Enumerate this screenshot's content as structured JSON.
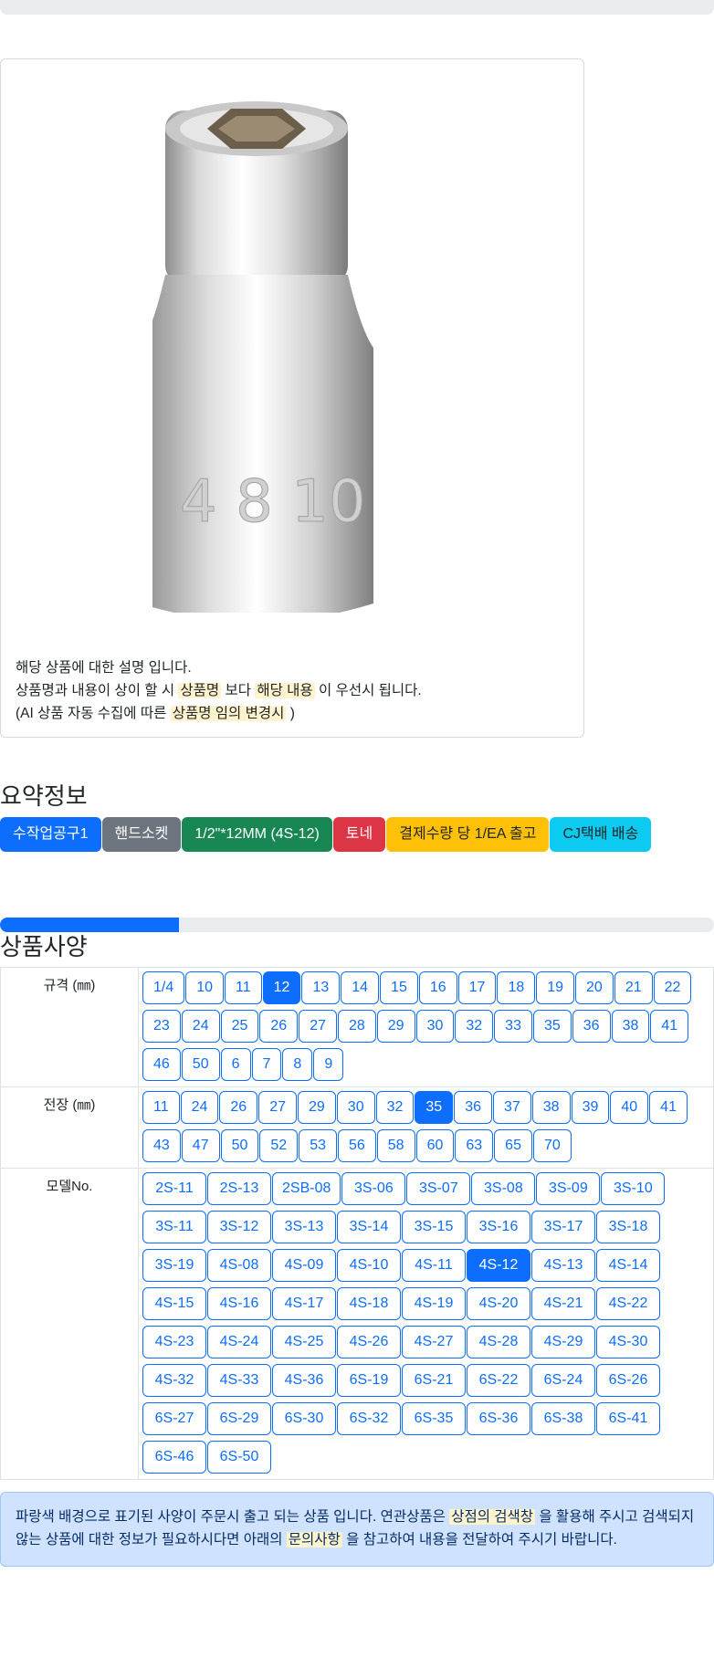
{
  "description": {
    "line1": "해당 상품에 대한 설명 입니다.",
    "line2_pre": "상품명과 내용이 상이 할 시 ",
    "line2_hl1": "상품명",
    "line2_mid": " 보다 ",
    "line2_hl2": "해당 내용",
    "line2_post": " 이 우선시 됩니다.",
    "line3_pre": "(AI 상품 자동 수집에 따른 ",
    "line3_hl": "상품명 임의 변경시",
    "line3_post": " )"
  },
  "summary": {
    "title": "요약정보",
    "badges": [
      "수작업공구1",
      "핸드소켓",
      "1/2\"*12MM (4S-12)",
      "토네",
      "결제수량 당 1/EA 출고",
      "CJ택배 배송"
    ]
  },
  "progress_fraction": 0.25,
  "specs": {
    "title": "상품사양",
    "size_label": "규격 (㎜)",
    "size_options": [
      "1/4",
      "10",
      "11",
      "12",
      "13",
      "14",
      "15",
      "16",
      "17",
      "18",
      "19",
      "20",
      "21",
      "22",
      "23",
      "24",
      "25",
      "26",
      "27",
      "28",
      "29",
      "30",
      "32",
      "33",
      "35",
      "36",
      "38",
      "41",
      "46",
      "50",
      "6",
      "7",
      "8",
      "9"
    ],
    "size_selected": "12",
    "length_label": "전장 (㎜)",
    "length_options": [
      "11",
      "24",
      "26",
      "27",
      "29",
      "30",
      "32",
      "35",
      "36",
      "37",
      "38",
      "39",
      "40",
      "41",
      "43",
      "47",
      "50",
      "52",
      "53",
      "56",
      "58",
      "60",
      "63",
      "65",
      "70"
    ],
    "length_selected": "35",
    "model_label": "모델No.",
    "model_options": [
      "2S-11",
      "2S-13",
      "2SB-08",
      "3S-06",
      "3S-07",
      "3S-08",
      "3S-09",
      "3S-10",
      "3S-11",
      "3S-12",
      "3S-13",
      "3S-14",
      "3S-15",
      "3S-16",
      "3S-17",
      "3S-18",
      "3S-19",
      "4S-08",
      "4S-09",
      "4S-10",
      "4S-11",
      "4S-12",
      "4S-13",
      "4S-14",
      "4S-15",
      "4S-16",
      "4S-17",
      "4S-18",
      "4S-19",
      "4S-20",
      "4S-21",
      "4S-22",
      "4S-23",
      "4S-24",
      "4S-25",
      "4S-26",
      "4S-27",
      "4S-28",
      "4S-29",
      "4S-30",
      "4S-32",
      "4S-33",
      "4S-36",
      "6S-19",
      "6S-21",
      "6S-22",
      "6S-24",
      "6S-26",
      "6S-27",
      "6S-29",
      "6S-30",
      "6S-32",
      "6S-35",
      "6S-36",
      "6S-38",
      "6S-41",
      "6S-46",
      "6S-50"
    ],
    "model_selected": "4S-12"
  },
  "notice": {
    "pre": "파랑색 배경으로 표기된 사양이 주문시 출고 되는 상품 입니다. 연관상품은 ",
    "hl1": "상점의 검색창",
    "mid": " 을 활용해 주시고 검색되지 않는 상품에 대한 정보가 필요하시다면 아래의 ",
    "hl2": "문의사항",
    "post": " 을 참고하여 내용을 전달하여 주시기 바랍니다."
  },
  "colors": {
    "primary": "#0d6efd",
    "highlight": "#fff3cd",
    "notice_bg": "#cfe2ff"
  }
}
